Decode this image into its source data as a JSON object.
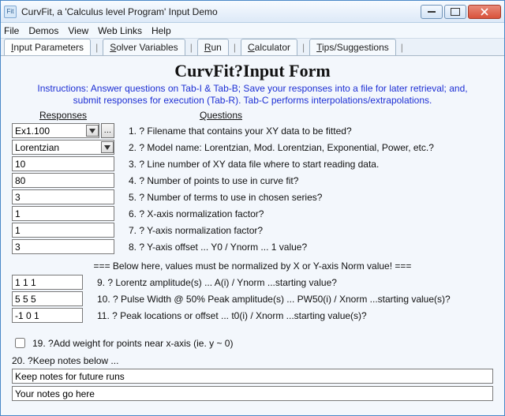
{
  "window": {
    "icon_label": "Fit",
    "title": "CurvFit, a 'Calculus level Program' Input Demo"
  },
  "menu": {
    "items": [
      "File",
      "Demos",
      "View",
      "Web Links",
      "Help"
    ]
  },
  "tabs": [
    {
      "prefix": "",
      "u": "I",
      "suffix": "nput Parameters"
    },
    {
      "prefix": "",
      "u": "S",
      "suffix": "olver Variables"
    },
    {
      "prefix": "",
      "u": "R",
      "suffix": "un"
    },
    {
      "prefix": "",
      "u": "C",
      "suffix": "alculator"
    },
    {
      "prefix": "",
      "u": "T",
      "suffix": "ips/Suggestions"
    }
  ],
  "form": {
    "title": "CurvFit?Input Form",
    "instructions_l1": "Instructions: Answer questions on Tab-I & Tab-B; Save your responses into a file for later retrieval; and,",
    "instructions_l2": "submit responses for execution (Tab-R). Tab-C performs interpolations/extrapolations.",
    "responses_head": "Responses",
    "questions_head": "Questions"
  },
  "responses": {
    "r1": "Ex1.100",
    "r2": "Lorentzian",
    "r3": "10",
    "r4": "80",
    "r5": "3",
    "r6": "1",
    "r7": "1",
    "r8": "3"
  },
  "questions": {
    "q1": "1. ? Filename that contains your XY data to be fitted?",
    "q2": "2. ? Model name: Lorentzian, Mod. Lorentzian, Exponential, Power, etc.?",
    "q3": "3. ? Line number of XY data file where to start reading data.",
    "q4": "4. ? Number of points to use in curve fit?",
    "q5": "5. ? Number of terms to use in chosen series?",
    "q6": "6. ? X-axis normalization factor?",
    "q7": "7. ? Y-axis normalization factor?",
    "q8": "8. ? Y-axis offset ... Y0 / Ynorm ... 1 value?"
  },
  "divider": "=== Below here, values must be normalized by X or Y-axis Norm value! ===",
  "responses2": {
    "r9": "1 1 1",
    "r10": "5 5 5",
    "r11": "-1 0 1"
  },
  "questions2": {
    "q9": "9. ?  Lorentz amplitude(s) ... A(i) / Ynorm ...starting value?",
    "q10": "10. ?  Pulse Width @ 50% Peak amplitude(s) ... PW50(i) / Xnorm ...starting value(s)?",
    "q11": "11. ?  Peak locations or offset ... t0(i) / Xnorm ...starting value(s)?"
  },
  "check19": "19. ?Add weight for points near x-axis (ie. y ~ 0)",
  "label20": "20. ?Keep notes below ...",
  "note_a": "Keep notes for future runs",
  "note_b": "Your notes go here",
  "file_btn_label": "…"
}
